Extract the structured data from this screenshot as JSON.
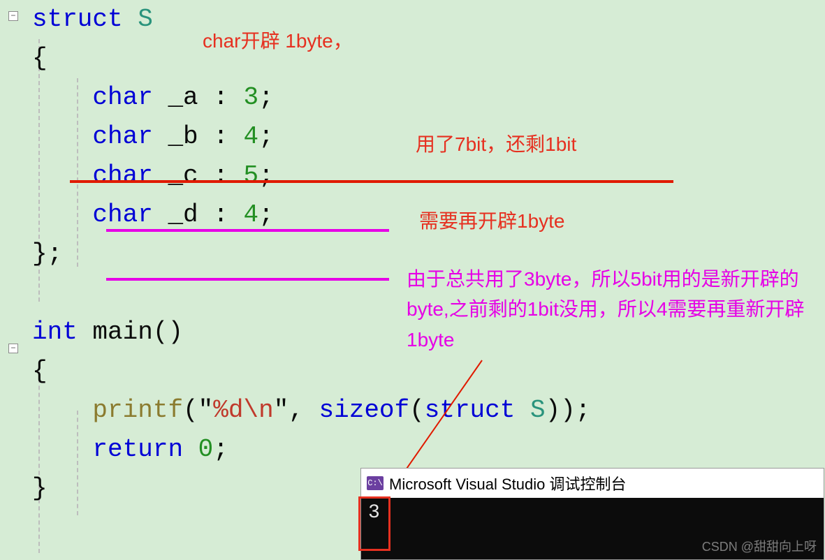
{
  "code": {
    "struct_kw": "struct",
    "struct_name": "S",
    "open_brace": "{",
    "field_type": "char",
    "fields": [
      {
        "name": "_a",
        "bits": "3"
      },
      {
        "name": "_b",
        "bits": "4"
      },
      {
        "name": "_c",
        "bits": "5"
      },
      {
        "name": "_d",
        "bits": "4"
      }
    ],
    "close_brace_semi": "};",
    "int_kw": "int",
    "main_name": "main",
    "paren": "()",
    "printf": "printf",
    "fmt_open": "(\"",
    "fmt_str": "%d",
    "esc_str": "\\n",
    "fmt_close": "\", ",
    "sizeof_kw": "sizeof",
    "sizeof_arg_open": "(",
    "sizeof_struct_kw": "struct",
    "sizeof_struct_name": "S",
    "sizeof_arg_close": "));",
    "return_kw": "return",
    "zero": "0",
    "semi": ";",
    "close_brace": "}"
  },
  "annotations": {
    "a1": "char开辟 1byte，",
    "a2": "用了7bit，还剩1bit",
    "a3": "需要再开辟1byte",
    "a4": "由于总共用了3byte，所以5bit用的是新开辟的byte,之前剩的1bit没用，所以4需要再重新开辟1byte"
  },
  "console": {
    "title": "Microsoft Visual Studio 调试控制台",
    "output": "3",
    "icon_label": "C:\\"
  },
  "watermark": "CSDN @甜甜向上呀"
}
